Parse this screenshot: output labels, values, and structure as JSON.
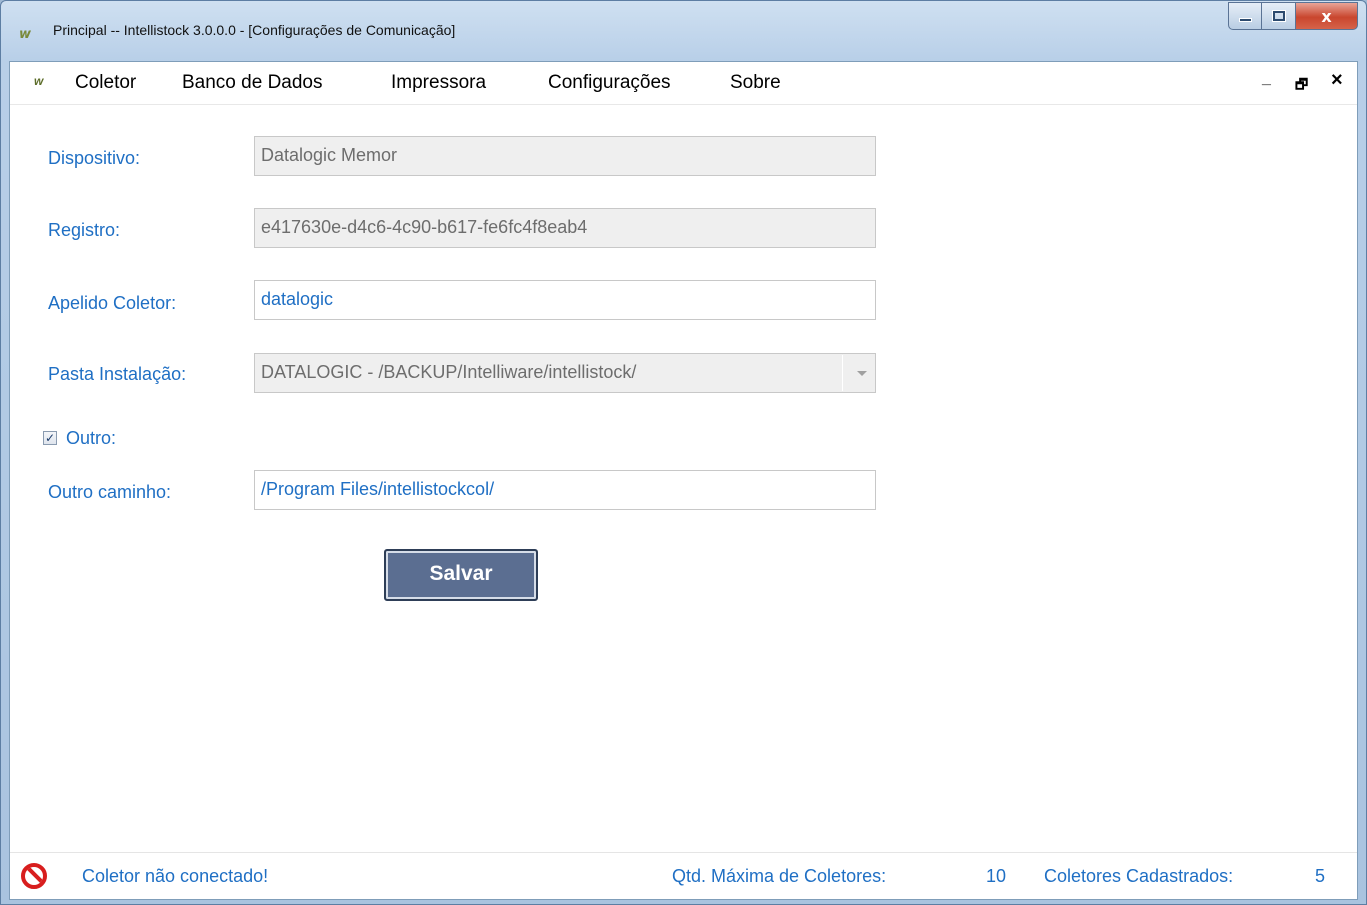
{
  "window": {
    "title": "Principal -- Intellistock 3.0.0.0 - [Configurações de Comunicação]",
    "logo_text": "w",
    "close_glyph": "x"
  },
  "menu": {
    "items": [
      "Coletor",
      "Banco de Dados",
      "Impressora",
      "Configurações",
      "Sobre"
    ],
    "mdi_minimize": "_",
    "mdi_restore": "🗗",
    "mdi_close": "×"
  },
  "form": {
    "dispositivo_label": "Dispositivo:",
    "dispositivo_value": "Datalogic Memor",
    "registro_label": "Registro:",
    "registro_value": "e417630e-d4c6-4c90-b617-fe6fc4f8eab4",
    "apelido_label": "Apelido Coletor:",
    "apelido_value": "datalogic",
    "pasta_label": "Pasta Instalação:",
    "pasta_value": "DATALOGIC - /BACKUP/Intelliware/intellistock/",
    "outro_label": "Outro:",
    "outro_checked": true,
    "outro_caminho_label": "Outro caminho:",
    "outro_caminho_value": "/Program Files/intellistockcol/",
    "save_label": "Salvar"
  },
  "status": {
    "message": "Coletor não conectado!",
    "max_label": "Qtd. Máxima de Coletores:",
    "max_value": "10",
    "registered_label": "Coletores Cadastrados:",
    "registered_value": "5",
    "icon": "no-entry-icon",
    "text_color": "#1f6fc4"
  }
}
